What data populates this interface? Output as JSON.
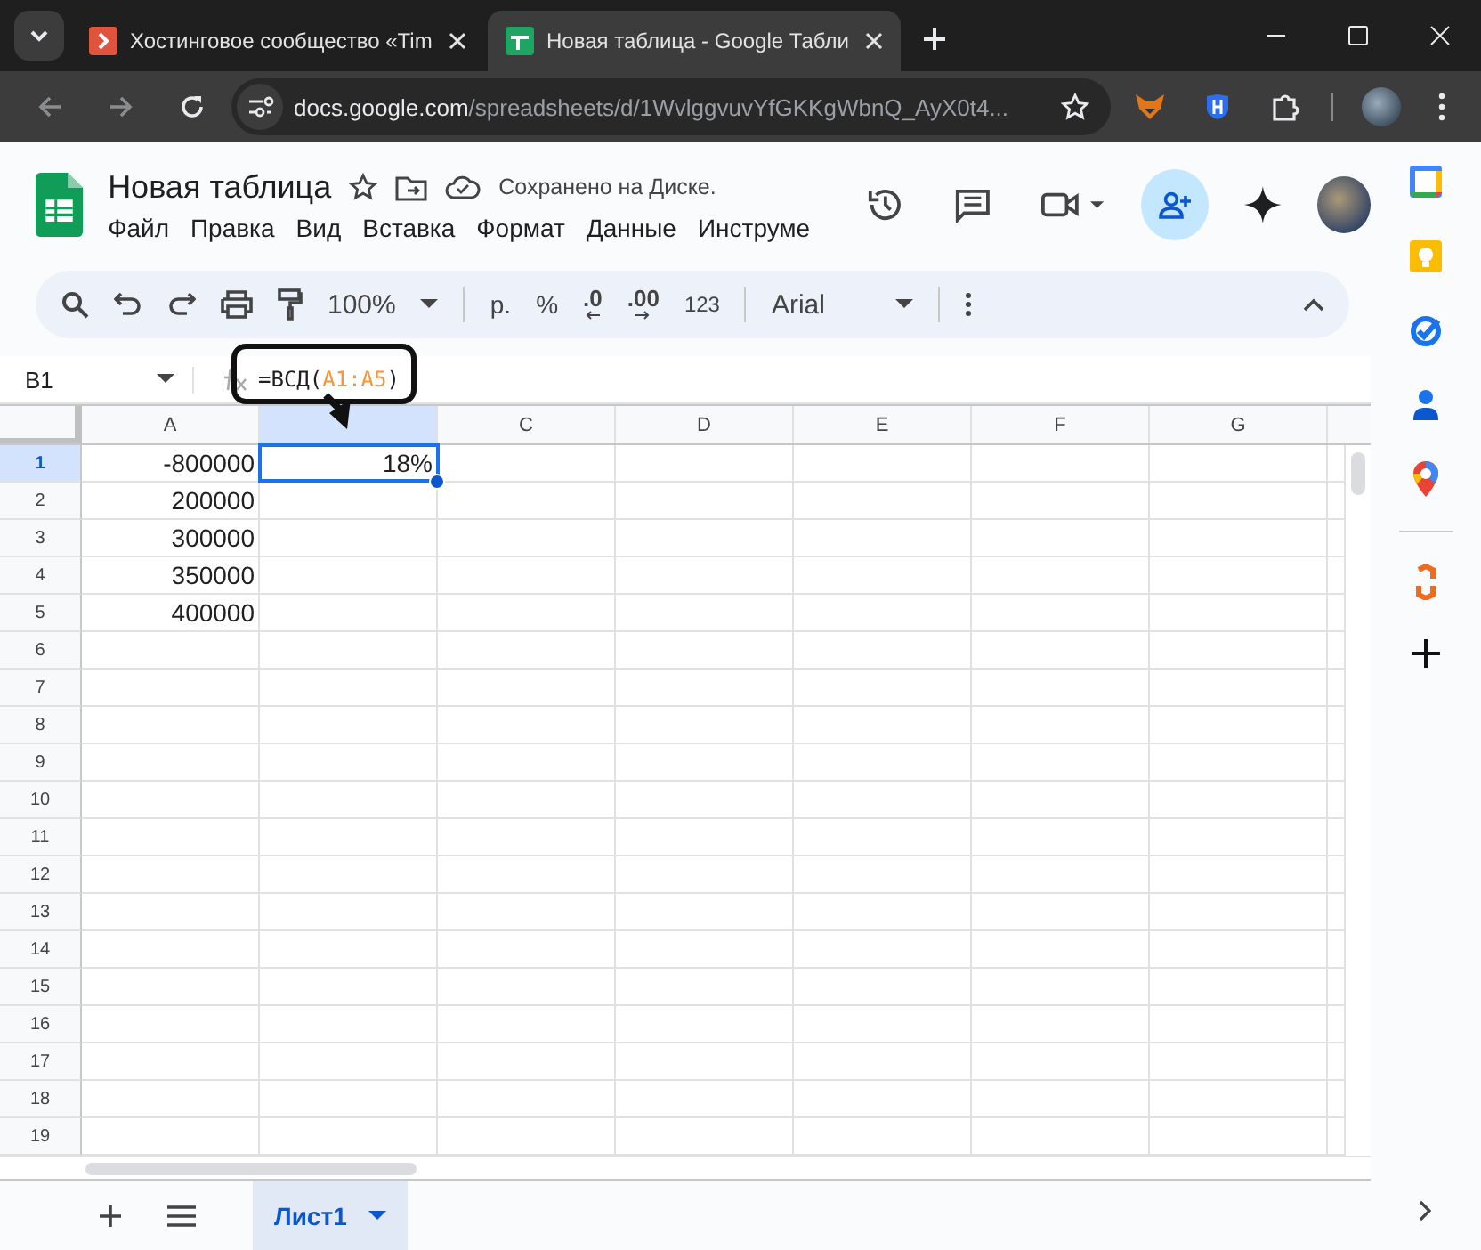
{
  "browser": {
    "tabs": [
      {
        "title": "Хостинговое сообщество «Tim",
        "selected": false,
        "kind": "site"
      },
      {
        "title": "Новая таблица - Google Табли",
        "selected": true,
        "kind": "sheets"
      }
    ],
    "url": {
      "domain": "docs.google.com",
      "path": "/spreadsheets/d/1WvlggvuvYfGKKgWbnQ_AyX0t4..."
    }
  },
  "document": {
    "title": "Новая таблица",
    "saved_status": "Сохранено на Диске.",
    "menu": [
      "Файл",
      "Правка",
      "Вид",
      "Вставка",
      "Формат",
      "Данные",
      "Инструме"
    ]
  },
  "toolbar": {
    "zoom": "100%",
    "currency": "р.",
    "percent": "%",
    "decrease_decimals": ".0",
    "increase_decimals": ".00",
    "more_formats": "123",
    "font": "Arial"
  },
  "formula_bar": {
    "cell_ref": "B1",
    "parts": [
      {
        "text": "=ВСД(",
        "kind": "plain"
      },
      {
        "text": "A1:A5",
        "kind": "range"
      },
      {
        "text": ")",
        "kind": "plain"
      }
    ]
  },
  "grid": {
    "columns": [
      {
        "label": "A",
        "selected": false
      },
      {
        "selected": true
      },
      {
        "label": "C",
        "selected": false
      },
      {
        "label": "D",
        "selected": false
      },
      {
        "label": "E",
        "selected": false
      },
      {
        "label": "F",
        "selected": false
      },
      {
        "label": "G",
        "selected": false
      }
    ],
    "rows": [
      {
        "number": "1",
        "selected": true,
        "cells": [
          {
            "text": "-800000",
            "selected": false
          },
          {
            "text": "18%",
            "selected": true
          }
        ]
      },
      {
        "number": "2",
        "selected": false,
        "cells": [
          {
            "text": "200000",
            "selected": false
          }
        ]
      },
      {
        "number": "3",
        "selected": false,
        "cells": [
          {
            "text": "300000",
            "selected": false
          }
        ]
      },
      {
        "number": "4",
        "selected": false,
        "cells": [
          {
            "text": "350000",
            "selected": false
          }
        ]
      },
      {
        "number": "5",
        "selected": false,
        "cells": [
          {
            "text": "400000",
            "selected": false
          }
        ]
      },
      {
        "number": "6",
        "selected": false,
        "cells": []
      },
      {
        "number": "7",
        "selected": false,
        "cells": []
      },
      {
        "number": "8",
        "selected": false,
        "cells": []
      },
      {
        "number": "9",
        "selected": false,
        "cells": []
      },
      {
        "number": "10",
        "selected": false,
        "cells": []
      },
      {
        "number": "11",
        "selected": false,
        "cells": []
      },
      {
        "number": "12",
        "selected": false,
        "cells": []
      },
      {
        "number": "13",
        "selected": false,
        "cells": []
      },
      {
        "number": "14",
        "selected": false,
        "cells": []
      },
      {
        "number": "15",
        "selected": false,
        "cells": []
      },
      {
        "number": "16",
        "selected": false,
        "cells": []
      },
      {
        "number": "17",
        "selected": false,
        "cells": []
      },
      {
        "number": "18",
        "selected": false,
        "cells": []
      },
      {
        "number": "19",
        "selected": false,
        "cells": []
      }
    ]
  },
  "sheet_tabs": [
    {
      "label": "Лист1",
      "selected": true
    }
  ]
}
